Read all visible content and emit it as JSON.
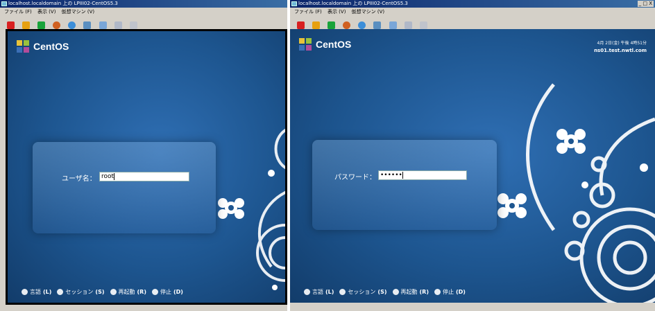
{
  "left_window": {
    "title": "localhost.localdomain 上の LPIII02-CentOS5.3",
    "menu": [
      "ファイル (F)",
      "表示 (V)",
      "仮想マシン (V)"
    ],
    "toolbar_icons": [
      "stop-icon",
      "pause-icon",
      "play-icon",
      "snapshot-icon",
      "revert-icon",
      "fullscreen-icon",
      "unity-icon",
      "forward-icon",
      "back-icon"
    ],
    "logo": "CentOS",
    "login_label": "ユーザ名：",
    "login_value": "root",
    "actions": [
      {
        "label": "言語",
        "key": "(L)"
      },
      {
        "label": "セッション",
        "key": "(S)"
      },
      {
        "label": "再起動",
        "key": "(R)"
      },
      {
        "label": "停止",
        "key": "(D)"
      }
    ]
  },
  "right_window": {
    "title": "localhost.localdomain 上の LPIII02-CentOS5.3",
    "menu": [
      "ファイル (F)",
      "表示 (V)",
      "仮想マシン (V)"
    ],
    "title_controls": "_ □ X",
    "logo": "CentOS",
    "clock": "4月 2日(金) 午後 4時51分",
    "hostname": "ns01.test.nwtl.com",
    "password_label": "パスワード：",
    "password_value": "••••••",
    "actions": [
      {
        "label": "言語",
        "key": "(L)"
      },
      {
        "label": "セッション",
        "key": "(S)"
      },
      {
        "label": "再起動",
        "key": "(R)"
      },
      {
        "label": "停止",
        "key": "(D)"
      }
    ]
  },
  "colors": {
    "background_blue": "#1d558f",
    "titlebar": "#0a246a",
    "panel": "#5c8fc8"
  }
}
